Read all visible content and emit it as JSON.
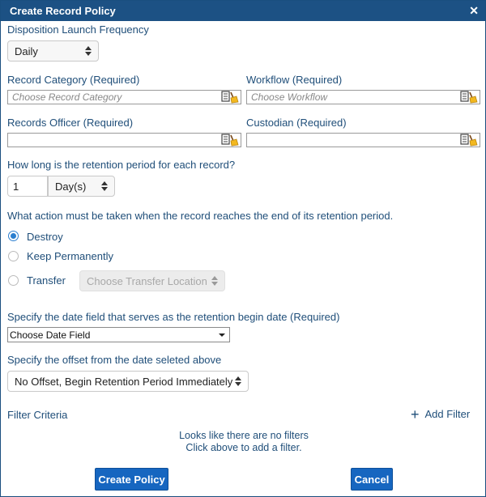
{
  "dialog": {
    "title": "Create Record Policy",
    "close": "✕"
  },
  "frequency": {
    "label": "Disposition Launch Frequency",
    "value": "Daily"
  },
  "record_category": {
    "label": "Record Category (Required)",
    "placeholder": "Choose Record Category"
  },
  "workflow": {
    "label": "Workflow (Required)",
    "placeholder": "Choose Workflow"
  },
  "records_officer": {
    "label": "Records Officer (Required)",
    "value": ""
  },
  "custodian": {
    "label": "Custodian (Required)",
    "value": ""
  },
  "retention": {
    "question": "How long is the retention period for each record?",
    "amount": "1",
    "unit": "Day(s)"
  },
  "action": {
    "question": "What action must be taken when the record reaches the end of its retention period.",
    "options": [
      "Destroy",
      "Keep Permanently",
      "Transfer"
    ],
    "selected": "Destroy",
    "transfer_location": "Choose Transfer Location"
  },
  "date_field": {
    "label": "Specify the date field that serves as the retention begin date (Required)",
    "value": "Choose Date Field"
  },
  "offset": {
    "label": "Specify the offset from the date seleted above",
    "value": "No Offset, Begin Retention Period Immediately"
  },
  "filter": {
    "label": "Filter Criteria",
    "add_label": "Add Filter",
    "empty_line1": "Looks like there are no filters",
    "empty_line2": "Click above to add a filter."
  },
  "buttons": {
    "create": "Create Policy",
    "cancel": "Cancel"
  },
  "colors": {
    "titlebar": "#1c5184",
    "label_text": "#1f4e79",
    "primary_button": "#1666c0",
    "radio_selected": "#2a7ecf"
  },
  "icons": {
    "picker": "address-book-broom-icon",
    "add": "plus-icon",
    "close": "close-icon"
  }
}
